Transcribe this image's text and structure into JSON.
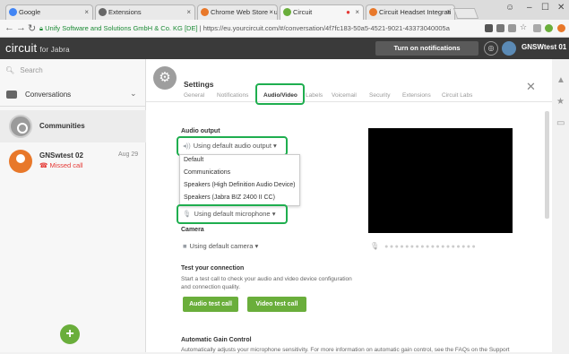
{
  "browser": {
    "tabs": [
      {
        "title": "Google",
        "icon_color": "#4285f4"
      },
      {
        "title": "Extensions",
        "icon_color": "#666666"
      },
      {
        "title": "Chrome Web Store - uni",
        "icon_color": "#e8782a"
      },
      {
        "title": "Circuit",
        "icon_color": "#6aae3b"
      },
      {
        "title": "Circuit Headset Integrati",
        "icon_color": "#e8782a"
      }
    ],
    "secure_label": "Unify Software and Solutions GmbH & Co. KG [DE]",
    "url": "https://eu.yourcircuit.com/#/conversation/4f7fc183-50a5-4521-9021-43373040005a"
  },
  "app": {
    "logo": "circuit",
    "logo_sub": "for Jabra",
    "notifications_button": "Turn on notifications",
    "username": "GNSWtest 01"
  },
  "sidebar": {
    "search_placeholder": "Search",
    "conversations_label": "Conversations",
    "communities_label": "Communities",
    "conversation": {
      "name": "GNSwtest 02",
      "date": "Aug 29",
      "status": "Missed call"
    }
  },
  "settings": {
    "title": "Settings",
    "tabs": [
      "General",
      "Notifications",
      "Audio/Video",
      "Labels",
      "Voicemail",
      "Security",
      "Extensions",
      "Circuit Labs"
    ],
    "active_tab": "Audio/Video",
    "audio_output_label": "Audio output",
    "audio_output_value": "Using default audio output",
    "audio_output_options": [
      "Default",
      "Communications",
      "Speakers (High Definition Audio Device)",
      "Speakers (Jabra BIZ 2400 II CC)"
    ],
    "microphone_value": "Using default microphone",
    "camera_label": "Camera",
    "camera_value": "Using default camera",
    "test_label": "Test your connection",
    "test_desc": "Start a test call to check your audio and video device configuration and connection quality.",
    "audio_test_button": "Audio test call",
    "video_test_button": "Video test call",
    "agc_label": "Automatic Gain Control",
    "agc_desc": "Automatically adjusts your microphone sensitivity. For more information on automatic gain control, see the FAQs on the Support"
  },
  "colors": {
    "accent_green": "#6aae3b",
    "highlight_green": "#1fae4f",
    "missed_red": "#e53935"
  }
}
